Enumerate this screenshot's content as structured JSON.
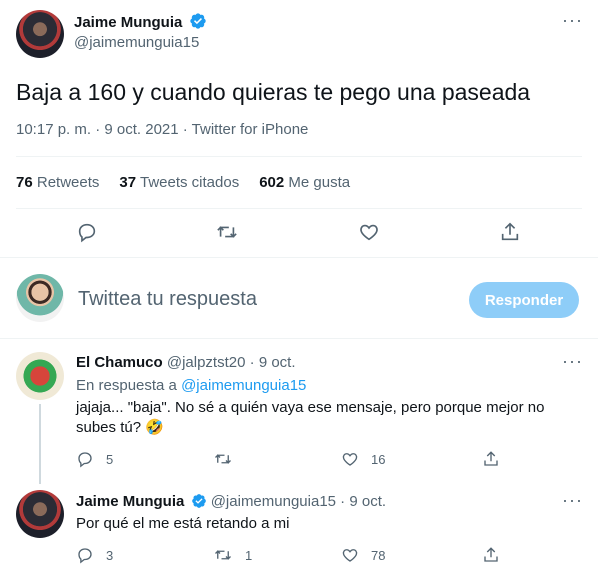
{
  "main_tweet": {
    "author_name": "Jaime Munguia",
    "author_handle": "@jaimemunguia15",
    "text": "Baja a 160 y cuando quieras te pego una paseada",
    "time": "10:17 p. m. · 9 oct. 2021 · ",
    "source": "Twitter for iPhone",
    "stats": {
      "retweets_count": "76",
      "retweets_label": "Retweets",
      "quotes_count": "37",
      "quotes_label": "Tweets citados",
      "likes_count": "602",
      "likes_label": "Me gusta"
    }
  },
  "reply_box": {
    "placeholder": "Twittea tu respuesta",
    "button_label": "Responder"
  },
  "replies": [
    {
      "author_name": "El Chamuco",
      "author_handle": "@jalpztst20",
      "separator": "·",
      "date": "9 oct.",
      "replying_to_label": "En respuesta a ",
      "replying_to_handle": "@jaimemunguia15",
      "text_line1": "jajaja... \"baja\". No sé a quién vaya ese mensaje, pero porque mejor no",
      "text_line2": "subes tú? 🤣",
      "reply_count": "5",
      "retweet_count": "",
      "like_count": "16"
    },
    {
      "author_name": "Jaime Munguia",
      "author_handle": "@jaimemunguia15",
      "separator": "·",
      "date": "9 oct.",
      "text": "Por qué el me está retando a mi",
      "reply_count": "3",
      "retweet_count": "1",
      "like_count": "78"
    }
  ],
  "colors": {
    "accent": "#1d9bf0",
    "reply_button_disabled": "#8ecdf8",
    "text_primary": "#0f1419",
    "text_secondary": "#536471",
    "divider": "#eff3f4"
  },
  "icons": [
    "verified-badge-icon",
    "more-icon",
    "reply-icon",
    "retweet-icon",
    "like-icon",
    "share-icon"
  ]
}
